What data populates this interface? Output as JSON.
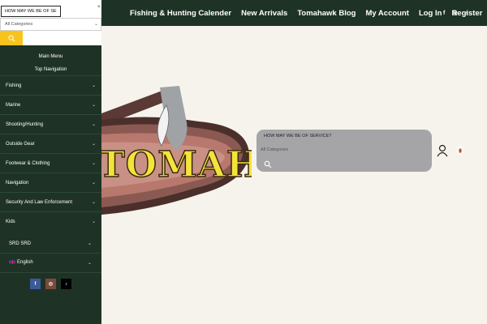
{
  "topbar": {
    "nav": [
      "Fishing & Hunting Calender",
      "New Arrivals",
      "Tomahawk Blog",
      "My Account",
      "Log In",
      "Register"
    ],
    "social": {
      "facebook": "f",
      "instagram": "◎",
      "tiktok": "♪"
    }
  },
  "sidebar": {
    "search_value": "HOW MAY WE BE OF SE",
    "category_select": "All Categories",
    "menu_tabs": [
      "Main Menu",
      "Top Navigation"
    ],
    "categories": [
      "Fishing",
      "Marine",
      "Shooting/Hunting",
      "Outside Gear",
      "Footwear & Clothing",
      "Navigation",
      "Security And Law Enforcement",
      "Kids"
    ],
    "currency": "SRD SRD",
    "language": "English",
    "social": {
      "facebook": "f",
      "instagram": "◎",
      "tiktok": "♪"
    }
  },
  "logo": {
    "text": "TOMAHAWK"
  },
  "search_card": {
    "title": "HOW MAY WE BE OF SERVICE?",
    "category_placeholder": "All Categories"
  },
  "colors": {
    "dark_green": "#1e3325",
    "accent_yellow": "#f8c31c",
    "background": "#f6f3ec",
    "card_grey": "#a5a5a7"
  }
}
